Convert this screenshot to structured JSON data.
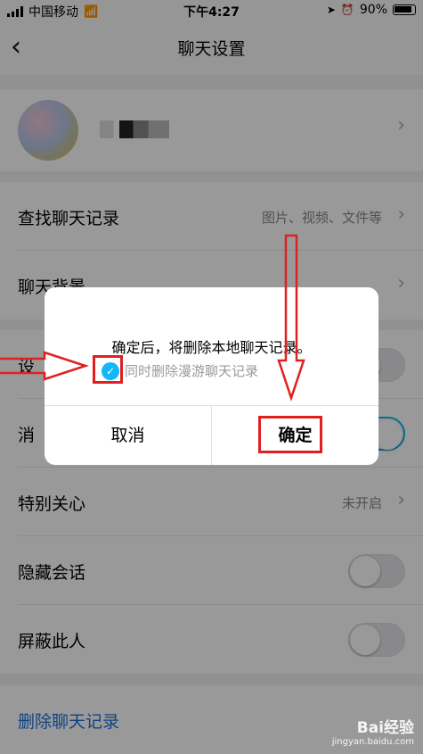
{
  "status_bar": {
    "carrier": "中国移动",
    "time": "下午4:27",
    "battery": "90%"
  },
  "nav": {
    "title": "聊天设置"
  },
  "profile": {
    "name": ""
  },
  "rows": [
    {
      "label": "查找聊天记录",
      "value": "图片、视频、文件等"
    },
    {
      "label": "聊天背景",
      "value": ""
    },
    {
      "label": "设",
      "value": ""
    },
    {
      "label": "消",
      "value": ""
    },
    {
      "label": "特别关心",
      "value": "未开启"
    },
    {
      "label": "隐藏会话",
      "value": ""
    },
    {
      "label": "屏蔽此人",
      "value": ""
    }
  ],
  "delete_link": "删除聊天记录",
  "dialog": {
    "message": "确定后，将删除本地聊天记录。",
    "option": "同时删除漫游聊天记录",
    "cancel": "取消",
    "confirm": "确定"
  },
  "watermark": {
    "name": "Bai经验",
    "url": "jingyan.baidu.com"
  },
  "colors": {
    "accent": "#12b7f5",
    "annotation": "#e02020",
    "link": "#1e6fd6"
  },
  "icons": [
    "back-chevron-icon",
    "wifi-icon",
    "location-icon",
    "alarm-icon",
    "chevron-right-icon",
    "checkmark-icon"
  ]
}
